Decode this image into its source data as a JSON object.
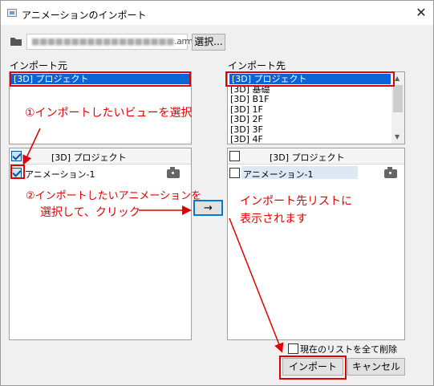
{
  "window": {
    "title": "アニメーションのインポート",
    "close": "✕"
  },
  "file": {
    "path_visible": ".armz",
    "select_button": "選択..."
  },
  "source": {
    "label": "インポート元",
    "views": [
      "[3D] プロジェクト"
    ],
    "panel_header": "[3D] プロジェクト",
    "animations": [
      "アニメーション-1"
    ]
  },
  "destination": {
    "label": "インポート先",
    "views": [
      "[3D] プロジェクト",
      "[3D] 基礎",
      "[3D] B1F",
      "[3D] 1F",
      "[3D] 2F",
      "[3D] 3F",
      "[3D] 4F"
    ],
    "panel_header": "[3D] プロジェクト",
    "animations": [
      "アニメーション-1"
    ]
  },
  "arrow_button": "→",
  "clear_option": "現在のリストを全て削除",
  "buttons": {
    "import": "インポート",
    "cancel": "キャンセル"
  },
  "annotations": {
    "step1": "①インポートしたいビューを選択",
    "step2_line1": "②インポートしたいアニメーションを",
    "step2_line2": "選択して、クリック",
    "step3_line1": "インポート先リストに",
    "step3_line2": "表示されます"
  },
  "colors": {
    "selection": "#0a64d6",
    "annotation": "#e00000"
  }
}
